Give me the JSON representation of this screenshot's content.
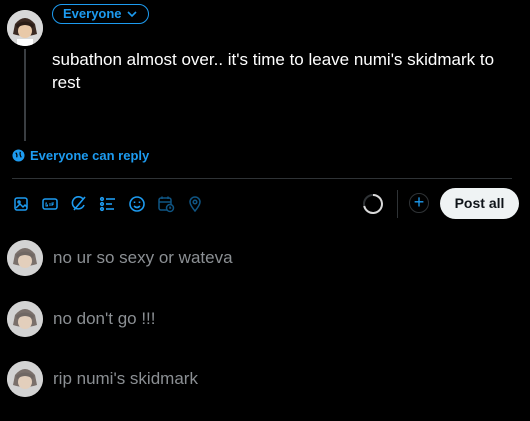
{
  "composer": {
    "audience_label": "Everyone",
    "text": "subathon almost over.. it's time to leave numi's skidmark to rest",
    "reply_setting_label": "Everyone can reply",
    "post_button_label": "Post all"
  },
  "toolbar": {
    "icons": [
      "image-icon",
      "gif-icon",
      "grok-icon",
      "poll-icon",
      "emoji-icon",
      "schedule-icon",
      "location-icon"
    ]
  },
  "drafts": [
    {
      "text": "no ur so sexy or wateva"
    },
    {
      "text": "no don't go !!!"
    },
    {
      "text": "rip numi's skidmark"
    }
  ],
  "colors": {
    "accent": "#1d9bf0",
    "background": "#000000",
    "muted_text": "#8b8f93"
  }
}
